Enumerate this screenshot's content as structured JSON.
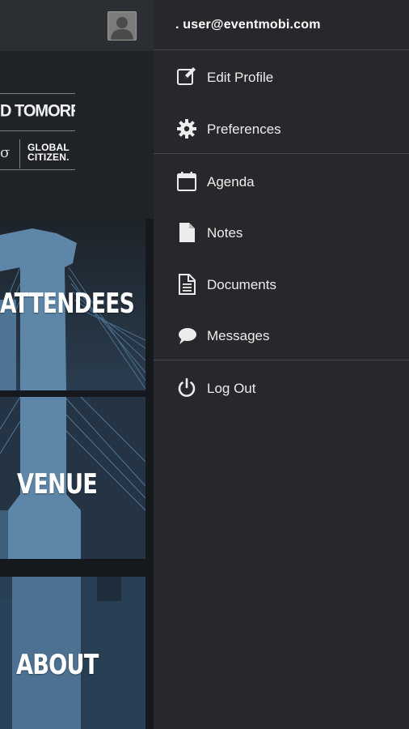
{
  "account": {
    "email": ". user@eventmobi.com"
  },
  "menu": {
    "profile_section": [
      {
        "id": "edit-profile",
        "label": "Edit Profile",
        "icon": "edit-icon"
      },
      {
        "id": "preferences",
        "label": "Preferences",
        "icon": "gear-icon"
      }
    ],
    "content_section": [
      {
        "id": "agenda",
        "label": "Agenda",
        "icon": "calendar-icon"
      },
      {
        "id": "notes",
        "label": "Notes",
        "icon": "note-icon"
      },
      {
        "id": "documents",
        "label": "Documents",
        "icon": "document-icon"
      },
      {
        "id": "messages",
        "label": "Messages",
        "icon": "chat-bubble-icon"
      }
    ],
    "session_section": [
      {
        "id": "log-out",
        "label": "Log Out",
        "icon": "power-icon"
      }
    ]
  },
  "background": {
    "banner_title": "D TOMORROW",
    "banner_symbol": "σ",
    "banner_logo_line1": "GLOBAL",
    "banner_logo_line2": "CITIZEN.",
    "tiles": [
      "ATTENDEES",
      "VENUE",
      "ABOUT"
    ]
  },
  "colors": {
    "drawer_bg": "#26282c",
    "separator": "#45484d",
    "bridge_blue": "#5e86a8",
    "tile_dark": "#1b1e22"
  }
}
